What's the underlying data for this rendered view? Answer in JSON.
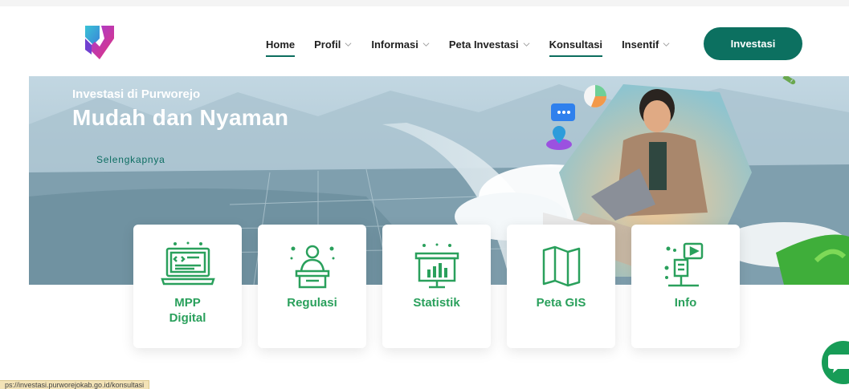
{
  "header": {
    "nav": [
      {
        "label": "Home",
        "has_dropdown": false,
        "underlined": true
      },
      {
        "label": "Profil",
        "has_dropdown": true,
        "underlined": false
      },
      {
        "label": "Informasi",
        "has_dropdown": true,
        "underlined": false
      },
      {
        "label": "Peta Investasi",
        "has_dropdown": true,
        "underlined": false
      },
      {
        "label": "Konsultasi",
        "has_dropdown": false,
        "underlined": true
      },
      {
        "label": "Insentif",
        "has_dropdown": true,
        "underlined": false
      }
    ],
    "cta_label": "Investasi"
  },
  "hero": {
    "subtitle": "Investasi di Purworejo",
    "title": "Mudah dan Nyaman",
    "link": "Selengkapnya"
  },
  "cards": [
    {
      "label": "MPP Digital",
      "icon": "computer-code-icon"
    },
    {
      "label": "Regulasi",
      "icon": "speaker-podium-icon"
    },
    {
      "label": "Statistik",
      "icon": "presentation-chart-icon"
    },
    {
      "label": "Peta GIS",
      "icon": "folded-map-icon"
    },
    {
      "label": "Info",
      "icon": "megaphone-video-icon"
    }
  ],
  "status_url": "ps://investasi.purworejokab.go.id/konsultasi",
  "colors": {
    "brand": "#0c7060",
    "card_text": "#2aa05c",
    "chat": "#179c57"
  }
}
